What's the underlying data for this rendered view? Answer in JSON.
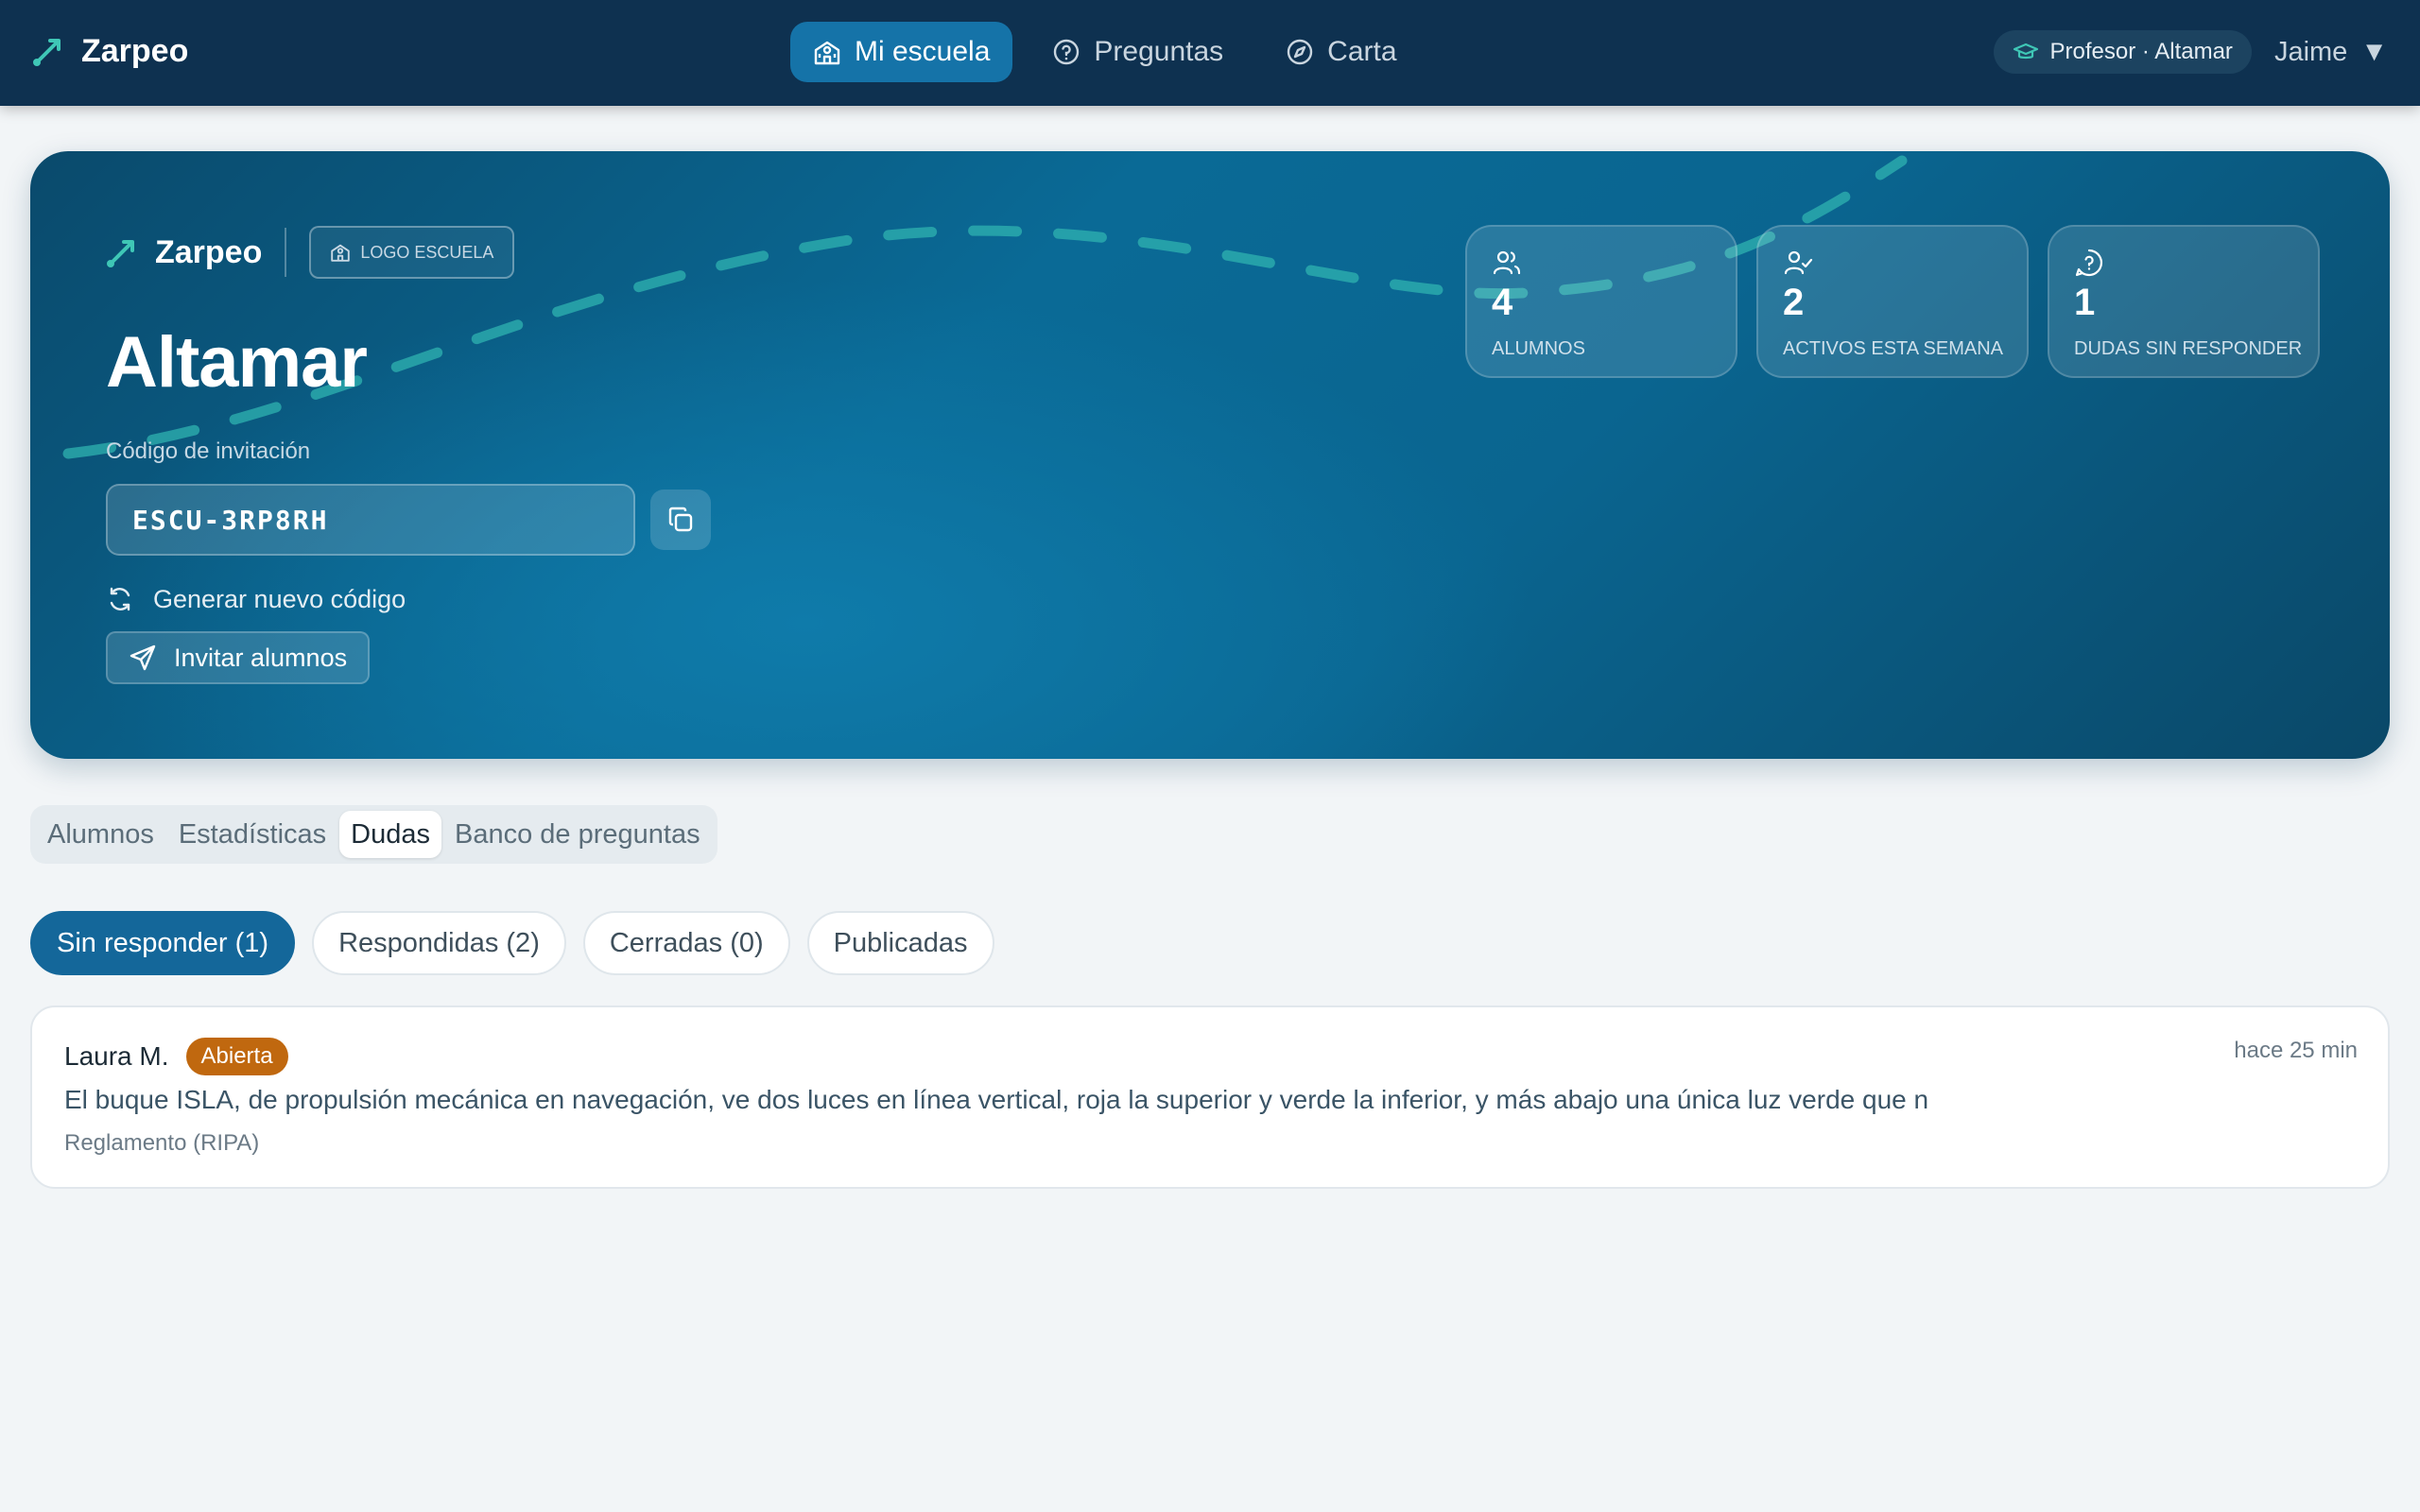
{
  "app": {
    "name": "Zarpeo"
  },
  "nav": {
    "tabs": [
      {
        "label": "Mi escuela",
        "icon": "school-icon",
        "active": true
      },
      {
        "label": "Preguntas",
        "icon": "help-circle-icon",
        "active": false
      },
      {
        "label": "Carta",
        "icon": "compass-icon",
        "active": false
      }
    ],
    "role": "Profesor · Altamar",
    "user": "Jaime",
    "user_caret": "▼"
  },
  "hero": {
    "brand": "Zarpeo",
    "logo_placeholder": "LOGO ESCUELA",
    "school_name": "Altamar",
    "invite_label": "Código de invitación",
    "invite_code": "ESCU-3RP8RH",
    "regenerate_label": "Generar nuevo código",
    "invite_button": "Invitar alumnos",
    "stats": [
      {
        "icon": "users-icon",
        "value": "4",
        "label": "Alumnos"
      },
      {
        "icon": "user-check-icon",
        "value": "2",
        "label": "Activos esta semana"
      },
      {
        "icon": "message-question-icon",
        "value": "1",
        "label": "Dudas sin responder"
      }
    ]
  },
  "section_tabs": [
    {
      "label": "Alumnos",
      "active": false
    },
    {
      "label": "Estadísticas",
      "active": false
    },
    {
      "label": "Dudas",
      "active": true
    },
    {
      "label": "Banco de preguntas",
      "active": false
    }
  ],
  "filters": [
    {
      "label": "Sin responder (1)",
      "active": true
    },
    {
      "label": "Respondidas (2)",
      "active": false
    },
    {
      "label": "Cerradas (0)",
      "active": false
    },
    {
      "label": "Publicadas",
      "active": false
    }
  ],
  "questions": [
    {
      "author": "Laura M.",
      "status": "Abierta",
      "time": "hace 25 min",
      "text": "El buque ISLA, de propulsión mecánica en navegación, ve dos luces en línea vertical, roja la superior y verde la inferior, y más abajo una única luz verde que n",
      "category": "Reglamento (RIPA)"
    }
  ],
  "colors": {
    "topbar": "#0e3150",
    "accent": "#1573a8",
    "brand_icon": "#3fc7b6",
    "badge_open": "#c0680f",
    "background": "#f2f5f7"
  }
}
